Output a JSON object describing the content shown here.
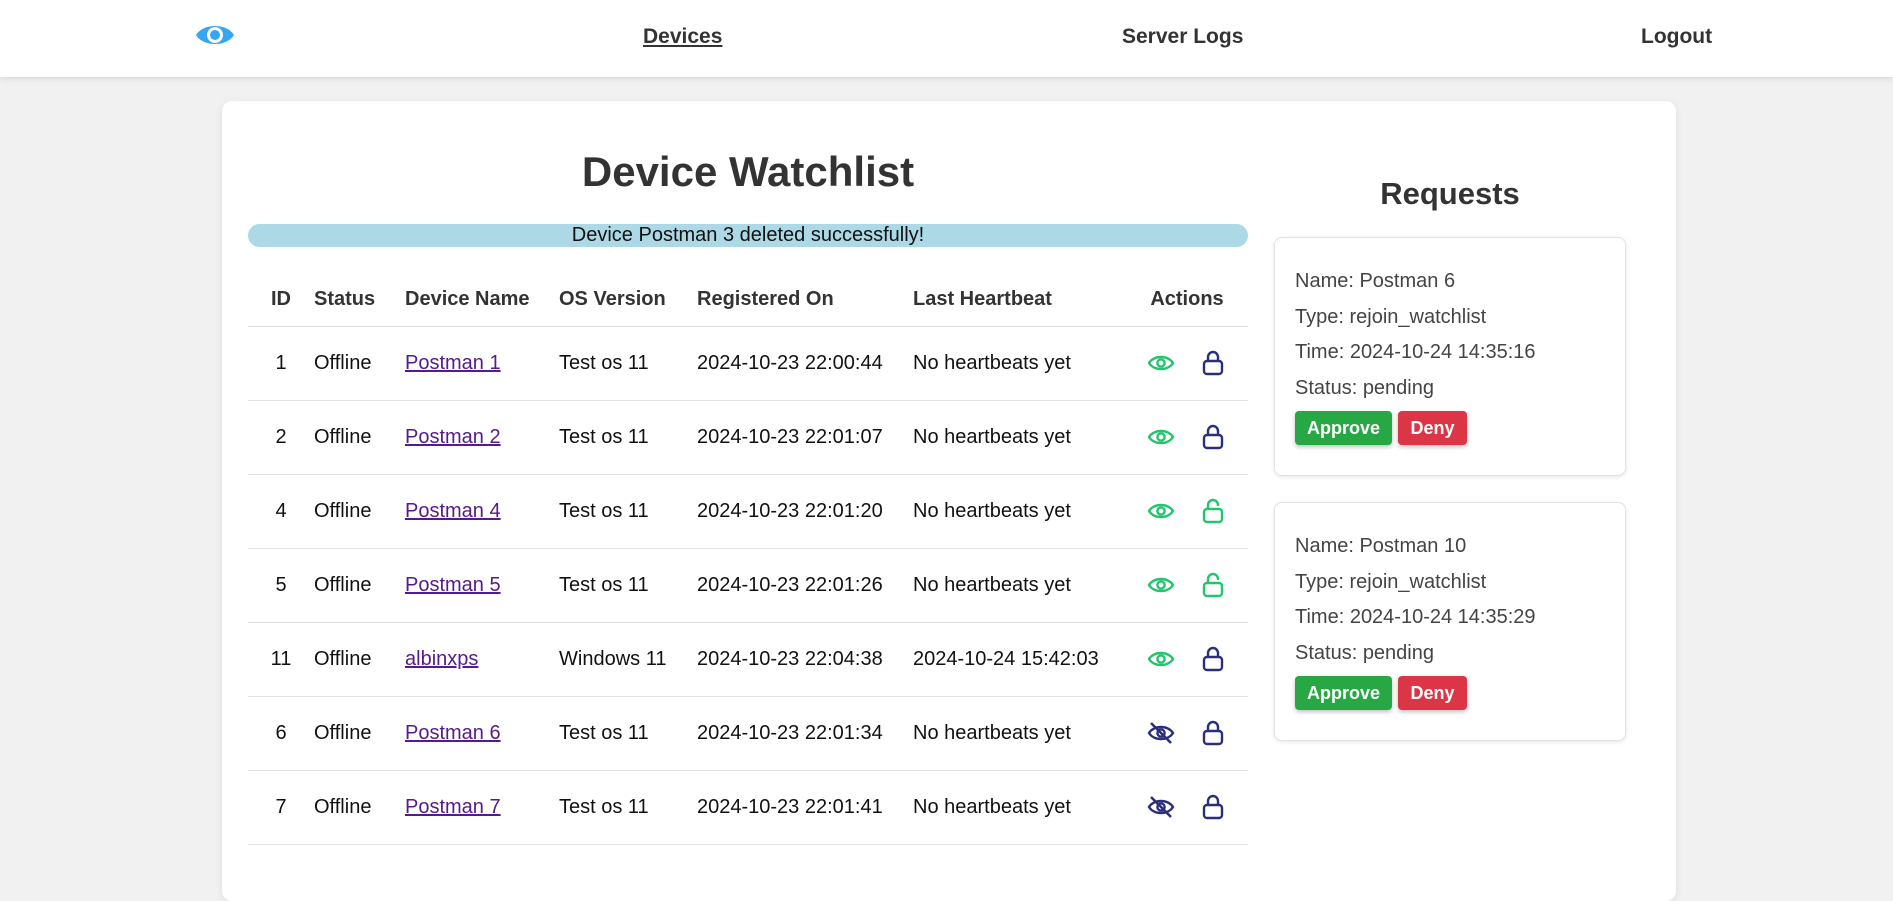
{
  "nav": {
    "logo_icon": "eye-icon",
    "links": [
      {
        "label": "Devices",
        "active": true
      },
      {
        "label": "Server Logs",
        "active": false
      },
      {
        "label": "Logout",
        "active": false
      }
    ]
  },
  "page": {
    "title": "Device Watchlist",
    "flash_message": "Device Postman 3 deleted successfully!"
  },
  "table": {
    "headers": [
      "ID",
      "Status",
      "Device Name",
      "OS Version",
      "Registered On",
      "Last Heartbeat",
      "Actions"
    ],
    "rows": [
      {
        "id": "1",
        "status": "Offline",
        "name": "Postman 1",
        "os": "Test os 11",
        "registered": "2024-10-23 22:00:44",
        "heartbeat": "No heartbeats yet",
        "watch_icon": "eye-icon",
        "lock_icon": "lock-closed-icon"
      },
      {
        "id": "2",
        "status": "Offline",
        "name": "Postman 2",
        "os": "Test os 11",
        "registered": "2024-10-23 22:01:07",
        "heartbeat": "No heartbeats yet",
        "watch_icon": "eye-icon",
        "lock_icon": "lock-closed-icon"
      },
      {
        "id": "4",
        "status": "Offline",
        "name": "Postman 4",
        "os": "Test os 11",
        "registered": "2024-10-23 22:01:20",
        "heartbeat": "No heartbeats yet",
        "watch_icon": "eye-icon",
        "lock_icon": "lock-open-icon"
      },
      {
        "id": "5",
        "status": "Offline",
        "name": "Postman 5",
        "os": "Test os 11",
        "registered": "2024-10-23 22:01:26",
        "heartbeat": "No heartbeats yet",
        "watch_icon": "eye-icon",
        "lock_icon": "lock-open-icon"
      },
      {
        "id": "11",
        "status": "Offline",
        "name": "albinxps",
        "os": "Windows 11",
        "registered": "2024-10-23 22:04:38",
        "heartbeat": "2024-10-24 15:42:03",
        "watch_icon": "eye-icon",
        "lock_icon": "lock-closed-icon"
      },
      {
        "id": "6",
        "status": "Offline",
        "name": "Postman 6",
        "os": "Test os 11",
        "registered": "2024-10-23 22:01:34",
        "heartbeat": "No heartbeats yet",
        "watch_icon": "eye-off-icon",
        "lock_icon": "lock-closed-icon"
      },
      {
        "id": "7",
        "status": "Offline",
        "name": "Postman 7",
        "os": "Test os 11",
        "registered": "2024-10-23 22:01:41",
        "heartbeat": "No heartbeats yet",
        "watch_icon": "eye-off-icon",
        "lock_icon": "lock-closed-icon"
      }
    ]
  },
  "requests": {
    "title": "Requests",
    "items": [
      {
        "name": "Name: Postman 6",
        "type": "Type: rejoin_watchlist",
        "time": "Time: 2024-10-24 14:35:16",
        "status": "Status: pending",
        "approve_label": "Approve",
        "deny_label": "Deny"
      },
      {
        "name": "Name: Postman 10",
        "type": "Type: rejoin_watchlist",
        "time": "Time: 2024-10-24 14:35:29",
        "status": "Status: pending",
        "approve_label": "Approve",
        "deny_label": "Deny"
      }
    ]
  },
  "colors": {
    "accent_blue": "#35a7f0",
    "eye_green": "#22c56b",
    "lock_navy": "#2b2f7a",
    "lock_open_green": "#22c56b",
    "offline_red": "#e11111",
    "approve_green": "#28a745",
    "deny_red": "#dc3545",
    "flash_bg": "#add8e6"
  }
}
